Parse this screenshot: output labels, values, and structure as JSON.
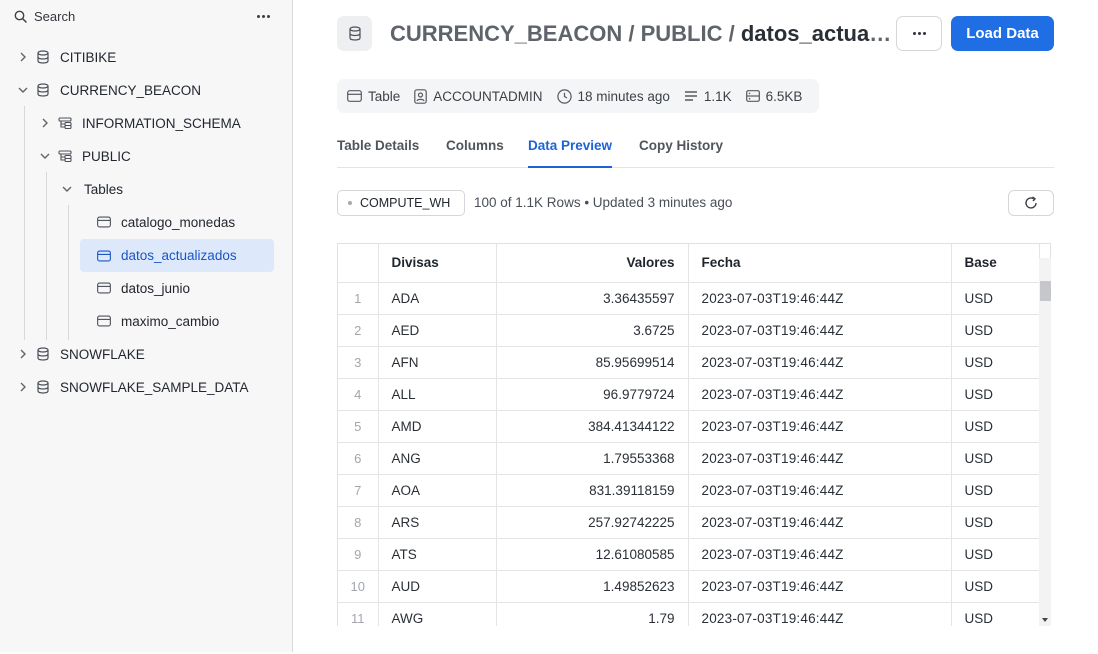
{
  "sidebar": {
    "search_label": "Search",
    "tree": [
      {
        "label": "CITIBIKE",
        "icon": "database-icon",
        "expanded": false
      },
      {
        "label": "CURRENCY_BEACON",
        "icon": "database-icon",
        "expanded": true
      },
      {
        "label": "INFORMATION_SCHEMA",
        "icon": "schema-icon",
        "expanded": false
      },
      {
        "label": "PUBLIC",
        "icon": "schema-icon",
        "expanded": true
      },
      {
        "label": "Tables",
        "icon": "none",
        "expanded": true
      },
      {
        "label": "catalogo_monedas",
        "icon": "table-icon"
      },
      {
        "label": "datos_actualizados",
        "icon": "table-icon",
        "selected": true
      },
      {
        "label": "datos_junio",
        "icon": "table-icon"
      },
      {
        "label": "maximo_cambio",
        "icon": "table-icon"
      },
      {
        "label": "SNOWFLAKE",
        "icon": "database-icon",
        "expanded": false
      },
      {
        "label": "SNOWFLAKE_SAMPLE_DATA",
        "icon": "database-icon",
        "expanded": false
      }
    ]
  },
  "header": {
    "path_prefix": "CURRENCY_BEACON / PUBLIC / ",
    "current": "datos_actualizados",
    "load_label": "Load Data"
  },
  "meta": {
    "type": "Table",
    "owner": "ACCOUNTADMIN",
    "modified": "18 minutes ago",
    "rows": "1.1K",
    "size": "6.5KB"
  },
  "tabs": [
    "Table Details",
    "Columns",
    "Data Preview",
    "Copy History"
  ],
  "active_tab": "Data Preview",
  "preview": {
    "warehouse": "COMPUTE_WH",
    "rows_info": "100 of 1.1K Rows • Updated 3 minutes ago"
  },
  "table": {
    "columns": [
      "Divisas",
      "Valores",
      "Fecha",
      "Base"
    ],
    "rows": [
      [
        "1",
        "ADA",
        "3.36435597",
        "2023-07-03T19:46:44Z",
        "USD"
      ],
      [
        "2",
        "AED",
        "3.6725",
        "2023-07-03T19:46:44Z",
        "USD"
      ],
      [
        "3",
        "AFN",
        "85.95699514",
        "2023-07-03T19:46:44Z",
        "USD"
      ],
      [
        "4",
        "ALL",
        "96.9779724",
        "2023-07-03T19:46:44Z",
        "USD"
      ],
      [
        "5",
        "AMD",
        "384.41344122",
        "2023-07-03T19:46:44Z",
        "USD"
      ],
      [
        "6",
        "ANG",
        "1.79553368",
        "2023-07-03T19:46:44Z",
        "USD"
      ],
      [
        "7",
        "AOA",
        "831.39118159",
        "2023-07-03T19:46:44Z",
        "USD"
      ],
      [
        "8",
        "ARS",
        "257.92742225",
        "2023-07-03T19:46:44Z",
        "USD"
      ],
      [
        "9",
        "ATS",
        "12.61080585",
        "2023-07-03T19:46:44Z",
        "USD"
      ],
      [
        "10",
        "AUD",
        "1.49852623",
        "2023-07-03T19:46:44Z",
        "USD"
      ],
      [
        "11",
        "AWG",
        "1.79",
        "2023-07-03T19:46:44Z",
        "USD"
      ]
    ]
  }
}
